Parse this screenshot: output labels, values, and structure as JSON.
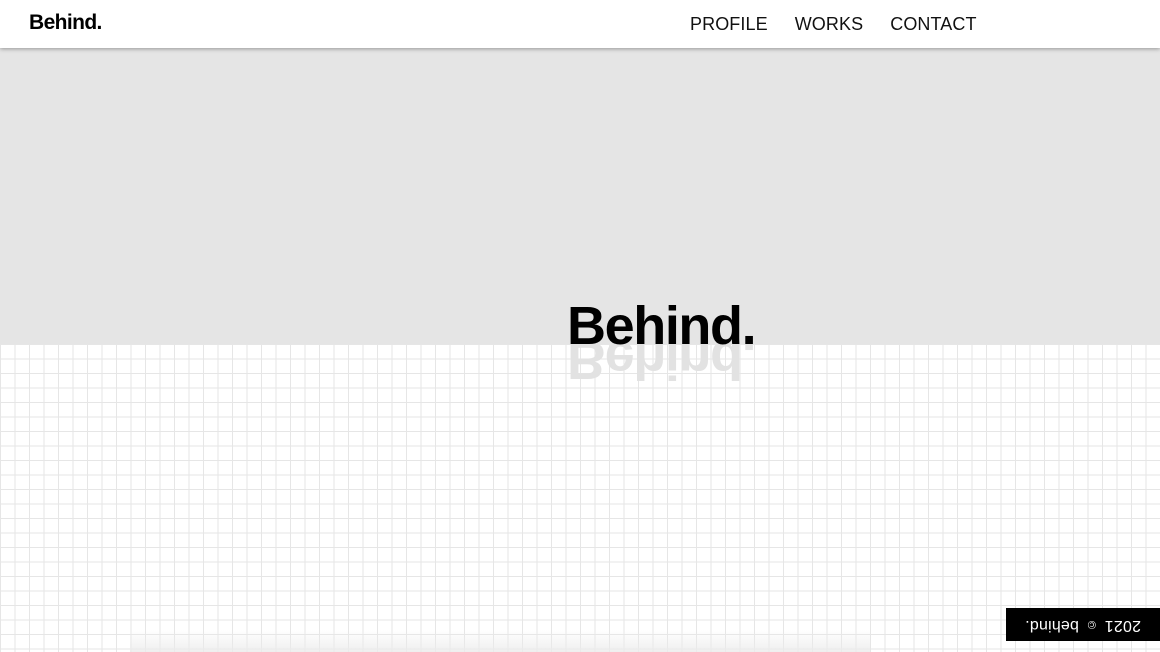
{
  "header": {
    "logo": "Behind.",
    "nav": {
      "profile": "PROFILE",
      "works": "WORKS",
      "contact": "CONTACT"
    }
  },
  "hero": {
    "title": "Behind.",
    "reflection": "Behind."
  },
  "footer": {
    "year": "2021",
    "copyright_symbol": "©",
    "name": "behind."
  },
  "colors": {
    "hero_background": "#e5e5e5",
    "grid_line": "#e6e6e6",
    "badge_background": "#000000"
  }
}
